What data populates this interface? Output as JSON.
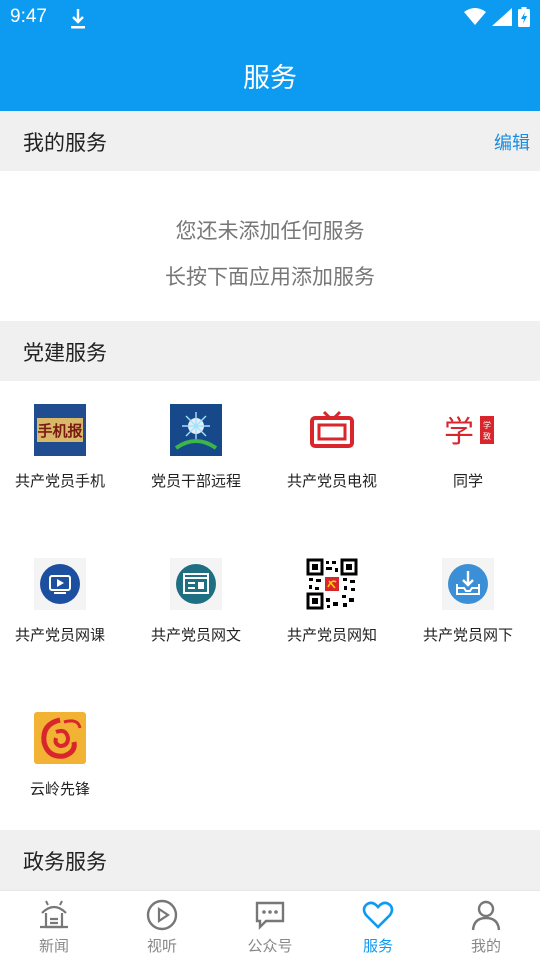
{
  "status_bar": {
    "time": "9:47"
  },
  "header": {
    "title": "服务"
  },
  "my_services": {
    "title": "我的服务",
    "edit_label": "编辑",
    "empty_line1": "您还未添加任何服务",
    "empty_line2": "长按下面应用添加服务"
  },
  "party_services": {
    "title": "党建服务",
    "items": [
      {
        "label": "共产党员手机",
        "icon": "newspaper-icon"
      },
      {
        "label": "党员干部远程",
        "icon": "remote-education-icon"
      },
      {
        "label": "共产党员电视",
        "icon": "tv-icon"
      },
      {
        "label": "同学",
        "icon": "classmate-icon"
      },
      {
        "label": "共产党员网课",
        "icon": "video-course-icon"
      },
      {
        "label": "共产党员网文",
        "icon": "article-icon"
      },
      {
        "label": "共产党员网知",
        "icon": "qr-code-icon"
      },
      {
        "label": "共产党员网下",
        "icon": "download-tray-icon"
      },
      {
        "label": "云岭先锋",
        "icon": "yunling-logo-icon"
      }
    ]
  },
  "gov_services": {
    "title": "政务服务"
  },
  "tabbar": {
    "tabs": [
      {
        "label": "新闻",
        "icon": "news-icon",
        "active": false
      },
      {
        "label": "视听",
        "icon": "play-icon",
        "active": false
      },
      {
        "label": "公众号",
        "icon": "chat-icon",
        "active": false
      },
      {
        "label": "服务",
        "icon": "heart-icon",
        "active": true
      },
      {
        "label": "我的",
        "icon": "user-icon",
        "active": false
      }
    ]
  },
  "colors": {
    "accent": "#0d9bf2",
    "section_bg": "#f0f0f0"
  }
}
